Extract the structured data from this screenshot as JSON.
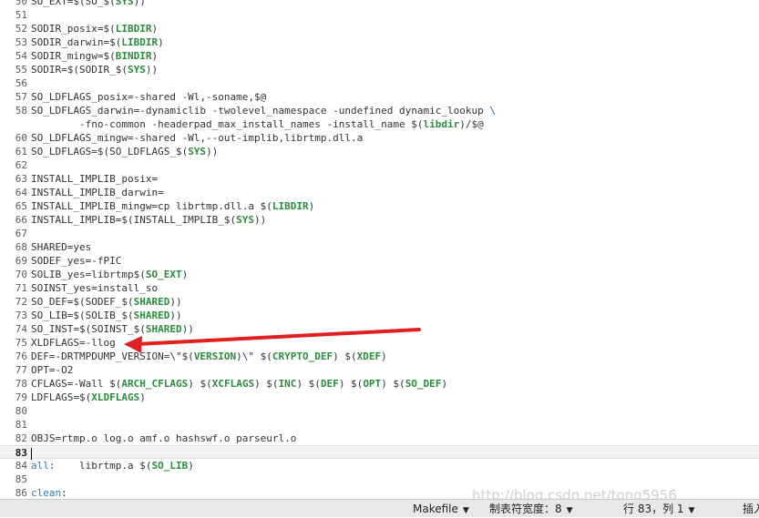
{
  "editor": {
    "lines": [
      {
        "num": "50",
        "segments": [
          {
            "t": "SO_EXT=$(SO_$("
          },
          {
            "t": "SYS",
            "c": "var"
          },
          {
            "t": "))"
          }
        ]
      },
      {
        "num": "51",
        "segments": []
      },
      {
        "num": "52",
        "segments": [
          {
            "t": "SODIR_posix=$("
          },
          {
            "t": "LIBDIR",
            "c": "var"
          },
          {
            "t": ")"
          }
        ]
      },
      {
        "num": "53",
        "segments": [
          {
            "t": "SODIR_darwin=$("
          },
          {
            "t": "LIBDIR",
            "c": "var"
          },
          {
            "t": ")"
          }
        ]
      },
      {
        "num": "54",
        "segments": [
          {
            "t": "SODIR_mingw=$("
          },
          {
            "t": "BINDIR",
            "c": "var"
          },
          {
            "t": ")"
          }
        ]
      },
      {
        "num": "55",
        "segments": [
          {
            "t": "SODIR=$(SODIR_$("
          },
          {
            "t": "SYS",
            "c": "var"
          },
          {
            "t": "))"
          }
        ]
      },
      {
        "num": "56",
        "segments": []
      },
      {
        "num": "57",
        "segments": [
          {
            "t": "SO_LDFLAGS_posix=-shared -Wl,-soname,$@"
          }
        ]
      },
      {
        "num": "58",
        "segments": [
          {
            "t": "SO_LDFLAGS_darwin=-dynamiclib -twolevel_namespace -undefined dynamic_lookup "
          },
          {
            "t": "\\",
            "c": "cont"
          }
        ]
      },
      {
        "num": "",
        "segments": [
          {
            "t": "        -fno-common -headerpad_max_install_names -install_name $("
          },
          {
            "t": "libdir",
            "c": "var"
          },
          {
            "t": ")/$@"
          }
        ]
      },
      {
        "num": "60",
        "segments": [
          {
            "t": "SO_LDFLAGS_mingw=-shared -Wl,--out-implib,librtmp.dll.a"
          }
        ]
      },
      {
        "num": "61",
        "segments": [
          {
            "t": "SO_LDFLAGS=$(SO_LDFLAGS_$("
          },
          {
            "t": "SYS",
            "c": "var"
          },
          {
            "t": "))"
          }
        ]
      },
      {
        "num": "62",
        "segments": []
      },
      {
        "num": "63",
        "segments": [
          {
            "t": "INSTALL_IMPLIB_posix="
          }
        ]
      },
      {
        "num": "64",
        "segments": [
          {
            "t": "INSTALL_IMPLIB_darwin="
          }
        ]
      },
      {
        "num": "65",
        "segments": [
          {
            "t": "INSTALL_IMPLIB_mingw=cp librtmp.dll.a $("
          },
          {
            "t": "LIBDIR",
            "c": "var"
          },
          {
            "t": ")"
          }
        ]
      },
      {
        "num": "66",
        "segments": [
          {
            "t": "INSTALL_IMPLIB=$(INSTALL_IMPLIB_$("
          },
          {
            "t": "SYS",
            "c": "var"
          },
          {
            "t": "))"
          }
        ]
      },
      {
        "num": "67",
        "segments": []
      },
      {
        "num": "68",
        "segments": [
          {
            "t": "SHARED=yes"
          }
        ]
      },
      {
        "num": "69",
        "segments": [
          {
            "t": "SODEF_yes=-fPIC"
          }
        ]
      },
      {
        "num": "70",
        "segments": [
          {
            "t": "SOLIB_yes=librtmp$("
          },
          {
            "t": "SO_EXT",
            "c": "var"
          },
          {
            "t": ")"
          }
        ]
      },
      {
        "num": "71",
        "segments": [
          {
            "t": "SOINST_yes=install_so"
          }
        ]
      },
      {
        "num": "72",
        "segments": [
          {
            "t": "SO_DEF=$(SODEF_$("
          },
          {
            "t": "SHARED",
            "c": "var"
          },
          {
            "t": "))"
          }
        ]
      },
      {
        "num": "73",
        "segments": [
          {
            "t": "SO_LIB=$(SOLIB_$("
          },
          {
            "t": "SHARED",
            "c": "var"
          },
          {
            "t": "))"
          }
        ]
      },
      {
        "num": "74",
        "segments": [
          {
            "t": "SO_INST=$(SOINST_$("
          },
          {
            "t": "SHARED",
            "c": "var"
          },
          {
            "t": "))"
          }
        ]
      },
      {
        "num": "75",
        "segments": [
          {
            "t": "XLDFLAGS=-llog"
          }
        ]
      },
      {
        "num": "76",
        "segments": [
          {
            "t": "DEF=-DRTMPDUMP_VERSION=\\\"$("
          },
          {
            "t": "VERSION",
            "c": "var"
          },
          {
            "t": ")\\\" $("
          },
          {
            "t": "CRYPTO_DEF",
            "c": "var"
          },
          {
            "t": ") $("
          },
          {
            "t": "XDEF",
            "c": "var"
          },
          {
            "t": ")"
          }
        ]
      },
      {
        "num": "77",
        "segments": [
          {
            "t": "OPT=-O2"
          }
        ]
      },
      {
        "num": "78",
        "segments": [
          {
            "t": "CFLAGS=-Wall $("
          },
          {
            "t": "ARCH_CFLAGS",
            "c": "var"
          },
          {
            "t": ") $("
          },
          {
            "t": "XCFLAGS",
            "c": "var"
          },
          {
            "t": ") $("
          },
          {
            "t": "INC",
            "c": "var"
          },
          {
            "t": ") $("
          },
          {
            "t": "DEF",
            "c": "var"
          },
          {
            "t": ") $("
          },
          {
            "t": "OPT",
            "c": "var"
          },
          {
            "t": ") $("
          },
          {
            "t": "SO_DEF",
            "c": "var"
          },
          {
            "t": ")"
          }
        ]
      },
      {
        "num": "79",
        "segments": [
          {
            "t": "LDFLAGS=$("
          },
          {
            "t": "XLDFLAGS",
            "c": "var"
          },
          {
            "t": ")"
          }
        ]
      },
      {
        "num": "80",
        "segments": []
      },
      {
        "num": "81",
        "segments": []
      },
      {
        "num": "82",
        "segments": [
          {
            "t": "OBJS=rtmp.o log.o amf.o hashswf.o parseurl.o"
          }
        ]
      },
      {
        "num": "83",
        "segments": [],
        "current": true
      },
      {
        "num": "84",
        "segments": [
          {
            "t": "all",
            "c": "kw"
          },
          {
            "t": ":    librtmp.a $("
          },
          {
            "t": "SO_LIB",
            "c": "var"
          },
          {
            "t": ")"
          }
        ]
      },
      {
        "num": "85",
        "segments": []
      },
      {
        "num": "86",
        "segments": [
          {
            "t": "clean",
            "c": "kw"
          },
          {
            "t": ":"
          }
        ]
      }
    ]
  },
  "statusbar": {
    "language": "Makefile",
    "tab_width": "制表符宽度：8",
    "position": "行 83，列 1",
    "insert_mode": "插入"
  },
  "watermark": "http://blog.csdn.net/tong5956",
  "colors": {
    "variable": "#2a8c3c",
    "keyword": "#2a7fb4",
    "arrow": "#e02020"
  }
}
